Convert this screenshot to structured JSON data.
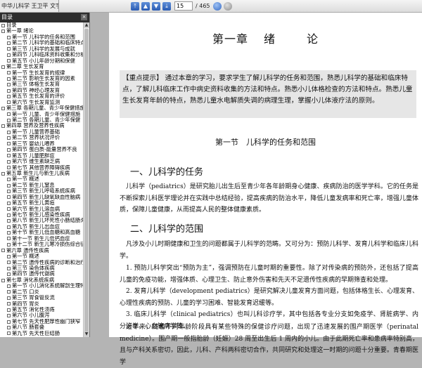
{
  "toolbar": {
    "doc_tab_title": "中华儿科学 王卫平 文字版",
    "close_glyph": "×",
    "current_page": "15",
    "total_pages": "/ 465",
    "nav_icons": [
      "first-page-icon",
      "prev-page-icon",
      "next-page-icon",
      "last-page-icon"
    ]
  },
  "sidebar": {
    "header": "目录",
    "collapse_glyph": "×",
    "items": [
      {
        "level": 0,
        "label": "目录"
      },
      {
        "level": 0,
        "label": "第一章 绪论"
      },
      {
        "level": 1,
        "label": "第一节 儿科学的任务和范围"
      },
      {
        "level": 1,
        "label": "第二节 儿科学的基础和临床特点"
      },
      {
        "level": 1,
        "label": "第三节 儿科学的发展与成就"
      },
      {
        "level": 1,
        "label": "第四节 儿科临床资料收集和分析"
      },
      {
        "level": 1,
        "label": "第五节 小儿年龄分期和保健"
      },
      {
        "level": 0,
        "label": "第二章 生长发育"
      },
      {
        "level": 1,
        "label": "第一节 生长发育的规律"
      },
      {
        "level": 1,
        "label": "第二节 影响生长发育的因素"
      },
      {
        "level": 1,
        "label": "第三节 体格生长发育"
      },
      {
        "level": 1,
        "label": "第四节 神经心理发育"
      },
      {
        "level": 1,
        "label": "第五节 生长发育的评价"
      },
      {
        "level": 1,
        "label": "第六节 生长发育监测"
      },
      {
        "level": 0,
        "label": "第三章 各期儿童、青少年保健措施"
      },
      {
        "level": 1,
        "label": "第一节 儿童、青少年保健措施"
      },
      {
        "level": 1,
        "label": "第二节 各期儿童、青少年保健"
      },
      {
        "level": 0,
        "label": "第四章 营养及营养性疾病"
      },
      {
        "level": 1,
        "label": "第一节 儿童营养基础"
      },
      {
        "level": 1,
        "label": "第二节 营养状况评价"
      },
      {
        "level": 1,
        "label": "第三节 婴幼儿喂养"
      },
      {
        "level": 1,
        "label": "第四节 蛋白质-能量营养不良"
      },
      {
        "level": 1,
        "label": "第五节 儿童肥胖症"
      },
      {
        "level": 1,
        "label": "第六节 维生素缺乏病"
      },
      {
        "level": 1,
        "label": "第七节 其他营养障碍疾病"
      },
      {
        "level": 0,
        "label": "第五章 新生儿与新生儿疾病"
      },
      {
        "level": 1,
        "label": "第一节 概述"
      },
      {
        "level": 1,
        "label": "第二节 新生儿窒息"
      },
      {
        "level": 1,
        "label": "第三节 新生儿呼吸系统疾病"
      },
      {
        "level": 1,
        "label": "第四节 新生儿缺氧缺血性脑病"
      },
      {
        "level": 1,
        "label": "第五节 新生儿黄疸"
      },
      {
        "level": 1,
        "label": "第六节 新生儿溶血病"
      },
      {
        "level": 1,
        "label": "第七节 新生儿感染性疾病"
      },
      {
        "level": 1,
        "label": "第八节 新生儿坏死性小肠结肠炎"
      },
      {
        "level": 1,
        "label": "第九节 新生儿出血症"
      },
      {
        "level": 1,
        "label": "第十节 新生儿低血糖和高血糖"
      },
      {
        "level": 1,
        "label": "第十一节 新生儿低钙血症"
      },
      {
        "level": 1,
        "label": "第十二节 新生儿寒冷损伤综合征"
      },
      {
        "level": 0,
        "label": "第六章 遗传性疾病"
      },
      {
        "level": 1,
        "label": "第一节 概述"
      },
      {
        "level": 1,
        "label": "第二节 遗传性疾病的诊断和治疗"
      },
      {
        "level": 1,
        "label": "第三节 染色体疾病"
      },
      {
        "level": 1,
        "label": "第四节 遗传代谢病"
      },
      {
        "level": 0,
        "label": "第七章 消化系统疾病"
      },
      {
        "level": 1,
        "label": "第一节 小儿消化系统解剖生理特点"
      },
      {
        "level": 1,
        "label": "第二节 口炎"
      },
      {
        "level": 1,
        "label": "第三节 胃食管反流"
      },
      {
        "level": 1,
        "label": "第四节 胃炎"
      },
      {
        "level": 1,
        "label": "第五节 消化性溃疡"
      },
      {
        "level": 1,
        "label": "第六节 小儿腹泻"
      },
      {
        "level": 1,
        "label": "第七节 先天性肥厚性幽门狭窄"
      },
      {
        "level": 1,
        "label": "第八节 肠套叠"
      },
      {
        "level": 1,
        "label": "第九节 先天性巨结肠"
      }
    ]
  },
  "page": {
    "chapter_prefix": "第一章",
    "chapter_w1": "绪",
    "chapter_w2": "论",
    "key_points": "【重点提示】 通过本章的学习，要求学生了解儿科学的任务和范围，熟悉儿科学的基础和临床特点，了解儿科临床工作中病史资料收集的方法和特点。熟悉小儿体格检查的方法和特点。熟悉儿童生长发育年龄的特点，熟悉儿童水电解质失调的病理生理，掌握小儿体液疗法的原则。",
    "section_title": "第一节　儿科学的任务和范围",
    "sub1": "一、儿科学的任务",
    "para1": "儿科学（pediatrics）是研究胎儿出生后至青少年各年龄期身心健康、疾病防治的医学学科。它的任务是不断探索儿科医学理论并在实践中总结经验，提高疾病的防治水平，降低儿童发病率和死亡率，增强儿童体质，保障儿童健康，从而提高人民的整体健康素质。",
    "sub2": "二、儿科学的范围",
    "para2": "凡涉及小儿时期健康和卫生的问题都属于儿科学的范畴。又可分为：预防儿科学、发育儿科学和临床儿科学。",
    "para3": "1. 预防儿科学突出“预防为主”，强调预防在儿童时期的重要性。除了对传染病的预防外，还包括了提高儿童的免疫功能，增强体质、心理卫生、防止意外伤害和先天不足遗传性疾病的早期筛查和处理。",
    "para4": "2. 发育儿科学（development pediatrics）是研究解决儿童发育方面问题，包括体格生长、心理发育、心理性疾病的预防、儿童的学习困难、智能发育迟缓等。",
    "para5": "3. 临床儿科学（clinical pediatrics）也叫儿科诊疗学，其中包括各专业分支如免疫学、肾脏病学、内分泌学、心血管病学等。",
    "para6": "近年来，随着不同年龄阶段具有某些特殊的保健诊疗问题，出现了迅速发展的围产期医学（perinatal medicine）。围产期一般指胎龄（妊娠）28 周至出生后 1 周内的小儿。由于此期死亡率和患病率特别高，且与产科关系密切，因此，儿科、产科两科密切合作，共同研究和处理这一时期的问题十分重要。青春期医学"
  }
}
